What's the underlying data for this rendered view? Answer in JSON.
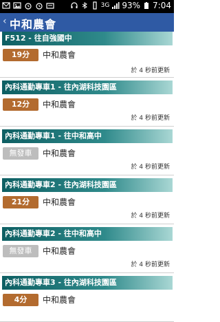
{
  "status_bar": {
    "network": "3G",
    "battery": "93%",
    "time": "7:04"
  },
  "header": {
    "title": "中和農會",
    "back_glyph": "‹"
  },
  "cards": [
    {
      "route": "F512 - 往自強國中",
      "eta": "19分",
      "eta_style": "brown",
      "stop": "中和農會",
      "updated": "於 4 秒前更新"
    },
    {
      "route": "內科通勤專車1 - 往內湖科技園區",
      "eta": "12分",
      "eta_style": "brown",
      "stop": "中和農會",
      "updated": "於 4 秒前更新"
    },
    {
      "route": "內科通勤專車1 - 往中和高中",
      "eta": "無發車",
      "eta_style": "gray",
      "stop": "中和農會",
      "updated": "於 4 秒前更新"
    },
    {
      "route": "內科通勤專車2 - 往內湖科技園區",
      "eta": "21分",
      "eta_style": "brown",
      "stop": "中和農會",
      "updated": "於 4 秒前更新"
    },
    {
      "route": "內科通勤專車2 - 往中和高中",
      "eta": "無發車",
      "eta_style": "gray",
      "stop": "中和農會",
      "updated": "於 4 秒前更新"
    },
    {
      "route": "內科通勤專車3 - 往內湖科技園區",
      "eta": "4分",
      "eta_style": "brown",
      "stop": "中和農會",
      "updated": ""
    }
  ]
}
